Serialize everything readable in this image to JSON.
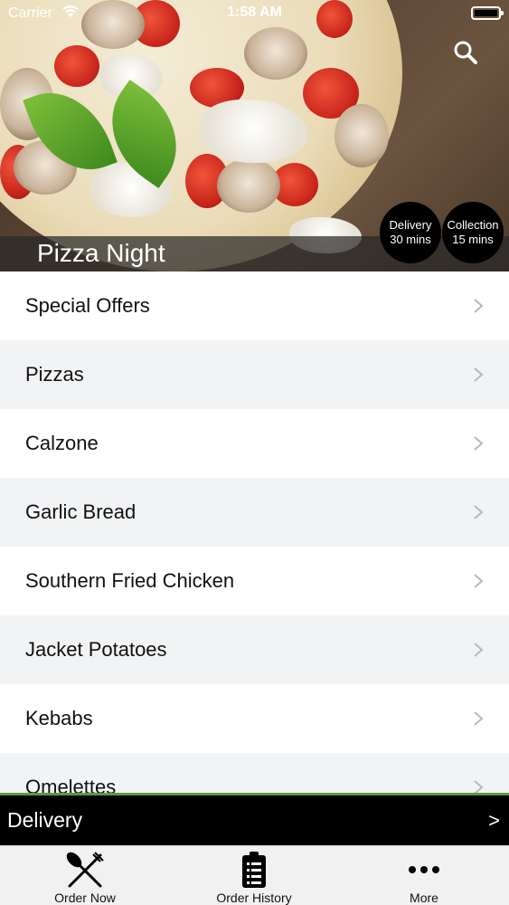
{
  "status_bar": {
    "carrier": "Carrier",
    "time": "1:58 AM"
  },
  "header": {
    "restaurant_name": "Pizza Night",
    "delivery_badge": {
      "line1": "Delivery",
      "line2": "30 mins"
    },
    "collection_badge": {
      "line1": "Collection",
      "line2": "15 mins"
    },
    "search_icon": "search-icon"
  },
  "menu": {
    "items": [
      {
        "label": "Special Offers"
      },
      {
        "label": "Pizzas"
      },
      {
        "label": "Calzone"
      },
      {
        "label": "Garlic Bread"
      },
      {
        "label": "Southern Fried Chicken"
      },
      {
        "label": "Jacket Potatoes"
      },
      {
        "label": "Kebabs"
      },
      {
        "label": "Omelettes"
      }
    ],
    "chevron_icon": "chevron-right-icon"
  },
  "order_bar": {
    "label": "Delivery",
    "arrow": ">"
  },
  "tab_bar": {
    "tabs": [
      {
        "label": "Order Now",
        "icon": "fork-knife-icon"
      },
      {
        "label": "Order History",
        "icon": "clipboard-list-icon"
      },
      {
        "label": "More",
        "icon": "more-dots-icon"
      }
    ]
  },
  "colors": {
    "accent_line": "#5a9a3c",
    "order_bar_bg": "#000000",
    "row_alt": "#f2f3f5"
  }
}
